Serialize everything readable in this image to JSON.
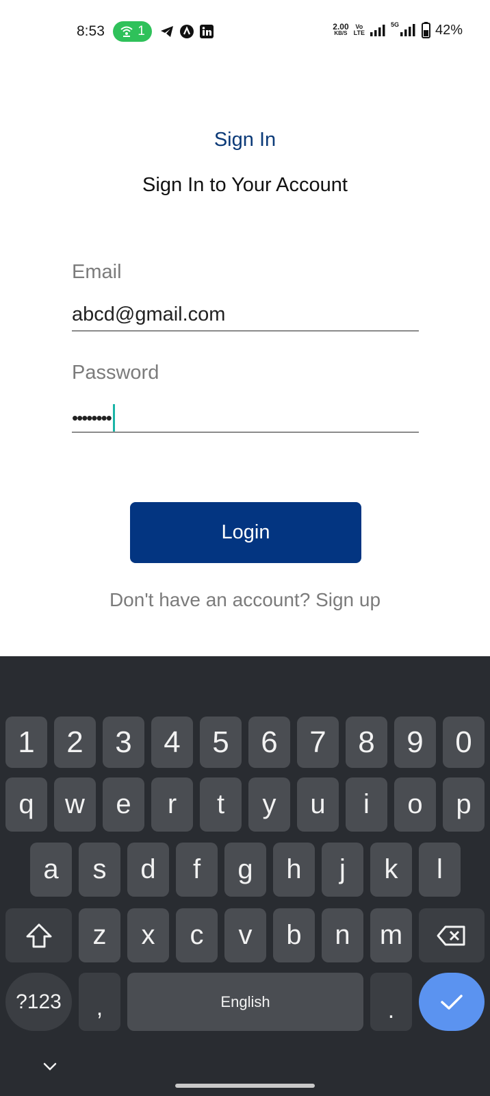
{
  "status_bar": {
    "time": "8:53",
    "hotspot_count": "1",
    "net_speed_value": "2.00",
    "net_speed_unit": "KB/S",
    "volte_top": "Vo",
    "volte_bottom": "LTE",
    "signal2_label": "5G",
    "battery_percent": "42%",
    "icons": [
      "hotspot-icon",
      "telegram-icon",
      "a-app-icon",
      "linkedin-icon",
      "signal-icon",
      "battery-icon"
    ]
  },
  "header": {
    "title": "Sign In",
    "subtitle": "Sign In to Your Account"
  },
  "form": {
    "email_label": "Email",
    "email_value": "abcd@gmail.com",
    "password_label": "Password",
    "password_masked": "••••••••",
    "login_label": "Login",
    "signup_text": "Don't have an account? Sign up"
  },
  "keyboard": {
    "row_numbers": [
      "1",
      "2",
      "3",
      "4",
      "5",
      "6",
      "7",
      "8",
      "9",
      "0"
    ],
    "row_q": [
      "q",
      "w",
      "e",
      "r",
      "t",
      "y",
      "u",
      "i",
      "o",
      "p"
    ],
    "row_a": [
      "a",
      "s",
      "d",
      "f",
      "g",
      "h",
      "j",
      "k",
      "l"
    ],
    "row_z": [
      "z",
      "x",
      "c",
      "v",
      "b",
      "n",
      "m"
    ],
    "symbols_label": "?123",
    "comma": ",",
    "space_label": "English",
    "period": ".",
    "accent_color": "#5b93f0"
  },
  "colors": {
    "primary": "#033581",
    "title": "#0b3a78",
    "caret": "#1ab5a7"
  }
}
